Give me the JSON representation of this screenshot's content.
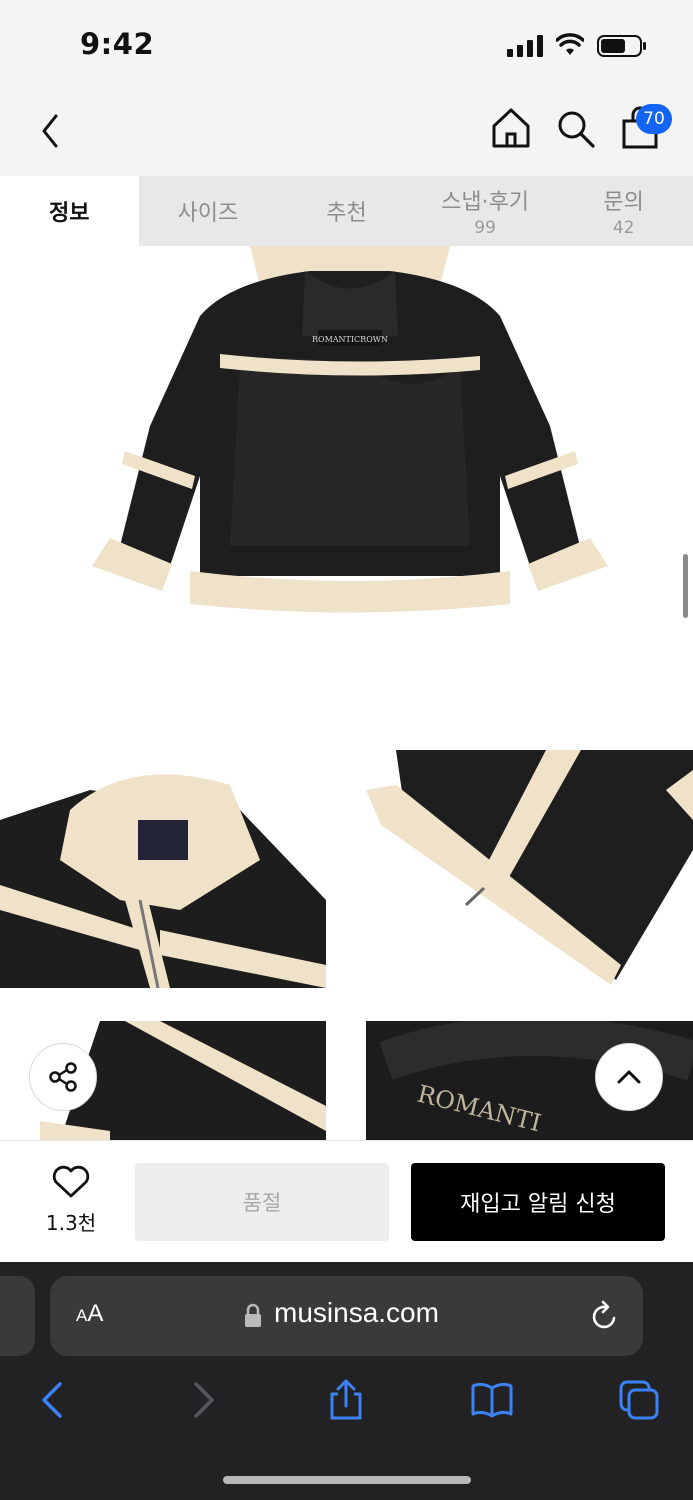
{
  "status_bar": {
    "time": "9:42"
  },
  "header": {
    "cart_count": "70"
  },
  "tabs": [
    {
      "label": "정보",
      "count": ""
    },
    {
      "label": "사이즈",
      "count": ""
    },
    {
      "label": "추천",
      "count": ""
    },
    {
      "label": "스냅·후기",
      "count": "99"
    },
    {
      "label": "문의",
      "count": "42"
    }
  ],
  "product": {
    "main_image": "black-shearling-jacket-back",
    "detail_images": [
      "collar-closeup",
      "front-zipper-closeup",
      "sleeve-closeup",
      "brand-label-closeup"
    ]
  },
  "action_bar": {
    "like_count": "1.3천",
    "soldout_label": "품절",
    "restock_label": "재입고 알림 신청"
  },
  "browser": {
    "aa_label_small": "A",
    "aa_label_large": "A",
    "url": "musinsa.com"
  },
  "colors": {
    "accent_badge": "#1464f5",
    "restock_button": "#000000",
    "soldout_button": "#ededed",
    "jacket_leather": "#1c1c1c",
    "shearling": "#efe2c8"
  }
}
